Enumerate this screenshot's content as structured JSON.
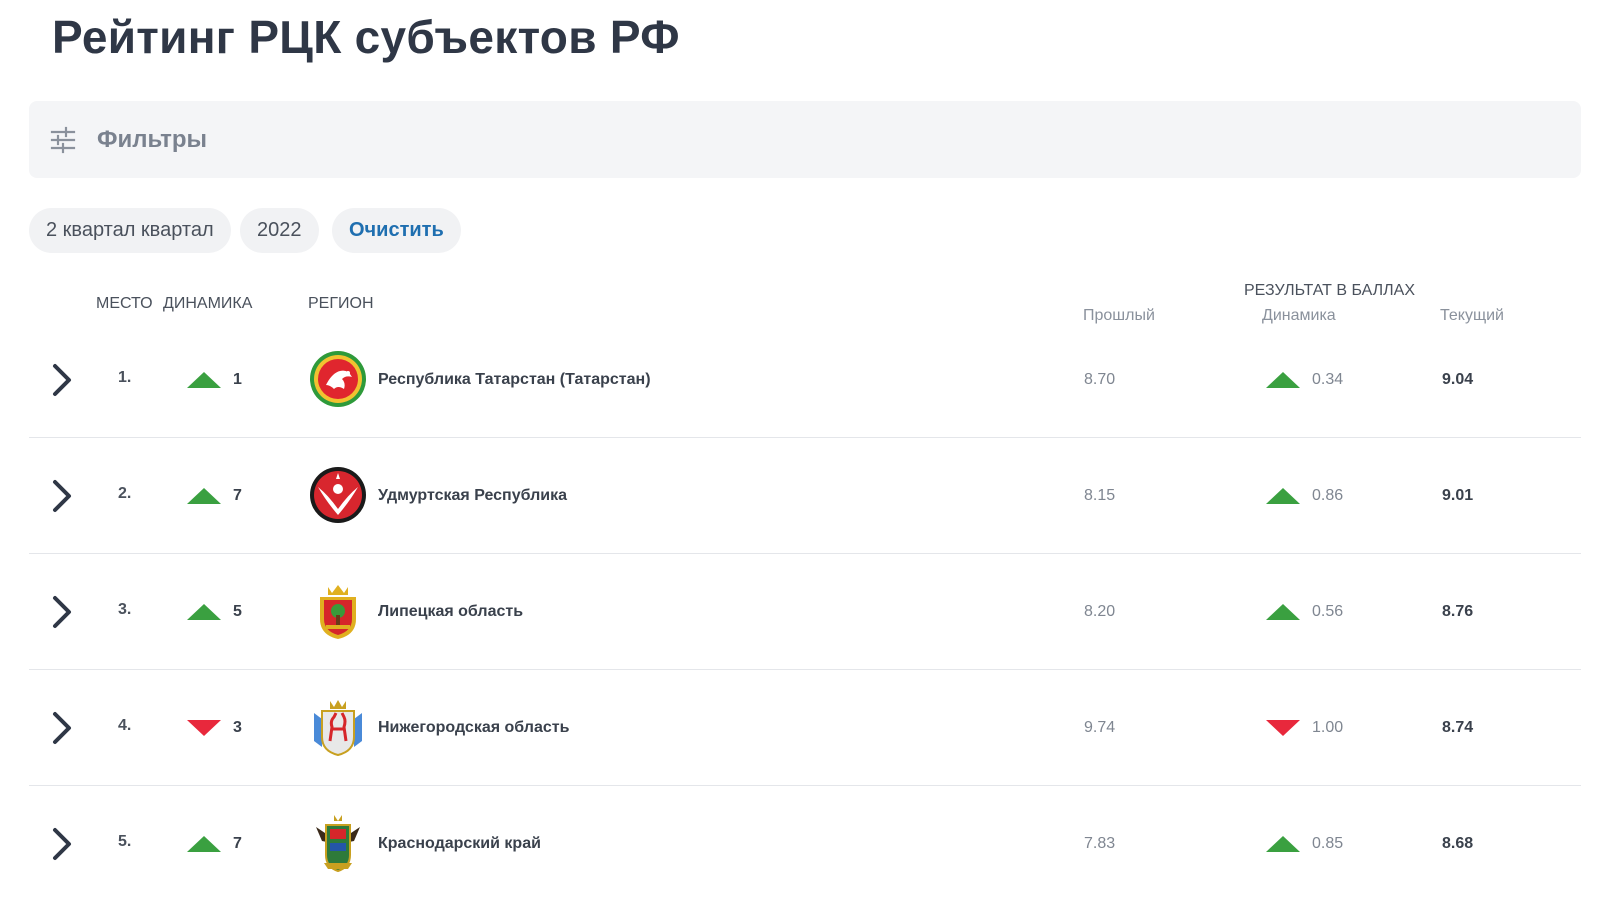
{
  "page": {
    "title": "Рейтинг РЦК субъектов РФ"
  },
  "filters": {
    "label": "Фильтры",
    "icon": "sliders-icon",
    "chips": [
      {
        "label": "2 квартал квартал"
      },
      {
        "label": "2022"
      }
    ],
    "clear_label": "Очистить"
  },
  "table": {
    "headers": {
      "place": "МЕСТО",
      "dynamics": "ДИНАМИКА",
      "region": "РЕГИОН",
      "score_group": "РЕЗУЛЬТАТ В БАЛЛАХ",
      "prev": "Прошлый",
      "score_dynamics": "Динамика",
      "current": "Текущий"
    },
    "rows": [
      {
        "place": "1.",
        "direction": "up",
        "change": "1",
        "region": "Республика Татарстан (Татарстан)",
        "emblem": "tatarstan-emblem-icon",
        "prev": "8.70",
        "score_direction": "up",
        "score_change": "0.34",
        "current": "9.04"
      },
      {
        "place": "2.",
        "direction": "up",
        "change": "7",
        "region": "Удмуртская Республика",
        "emblem": "udmurtia-emblem-icon",
        "prev": "8.15",
        "score_direction": "up",
        "score_change": "0.86",
        "current": "9.01"
      },
      {
        "place": "3.",
        "direction": "up",
        "change": "5",
        "region": "Липецкая область",
        "emblem": "lipetsk-emblem-icon",
        "prev": "8.20",
        "score_direction": "up",
        "score_change": "0.56",
        "current": "8.76"
      },
      {
        "place": "4.",
        "direction": "down",
        "change": "3",
        "region": "Нижегородская область",
        "emblem": "nizhny-novgorod-emblem-icon",
        "prev": "9.74",
        "score_direction": "down",
        "score_change": "1.00",
        "current": "8.74"
      },
      {
        "place": "5.",
        "direction": "up",
        "change": "7",
        "region": "Краснодарский край",
        "emblem": "krasnodar-emblem-icon",
        "prev": "7.83",
        "score_direction": "up",
        "score_change": "0.85",
        "current": "8.68"
      }
    ]
  },
  "colors": {
    "up": "#3aa040",
    "down": "#e8283c",
    "link": "#1f6fb0",
    "title": "#2f3746"
  }
}
